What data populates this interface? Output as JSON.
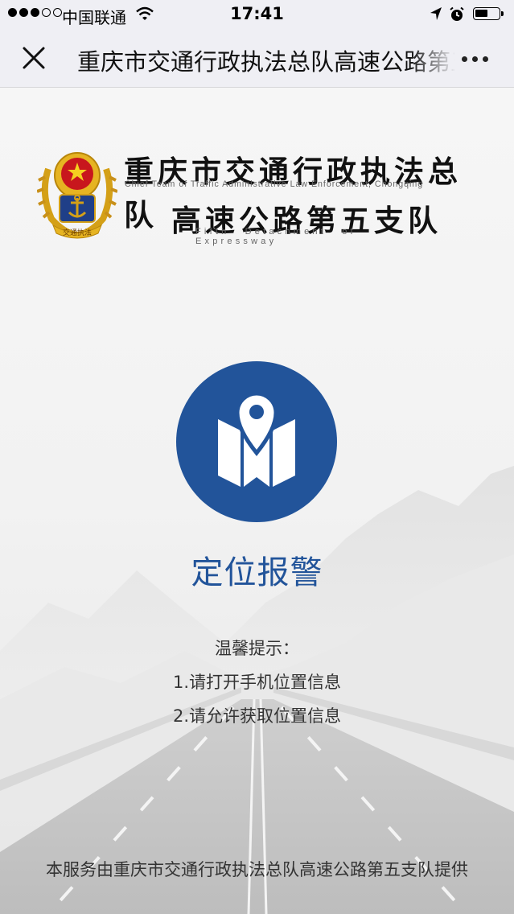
{
  "status_bar": {
    "carrier": "中国联通",
    "time": "17:41",
    "signal_bars_filled": 3,
    "signal_bars_total": 5,
    "battery_level": 0.55
  },
  "nav": {
    "title": "重庆市交通行政执法总队高速公路第五支队",
    "close_icon": "close-icon",
    "more_icon": "more-icon"
  },
  "header": {
    "emblem_text": "交通执法",
    "org_name_cn_1": "重庆市交通行政执法总队",
    "org_name_en_1": "Chief Team of Traffic Administrative Law Enforcement, Chongqing",
    "org_name_cn_2": "高速公路第五支队",
    "org_name_en_2": "Fifth Detachment of Expressway"
  },
  "action": {
    "icon": "map-pin-icon",
    "label": "定位报警"
  },
  "tips": {
    "title": "温馨提示：",
    "items": [
      "1.请打开手机位置信息",
      "2.请允许获取位置信息"
    ]
  },
  "footer": {
    "text": "本服务由重庆市交通行政执法总队高速公路第五支队提供"
  },
  "colors": {
    "primary": "#22549a",
    "nav_bg": "#efeff4",
    "emblem_gold": "#d4a017",
    "emblem_red": "#c8161d"
  }
}
